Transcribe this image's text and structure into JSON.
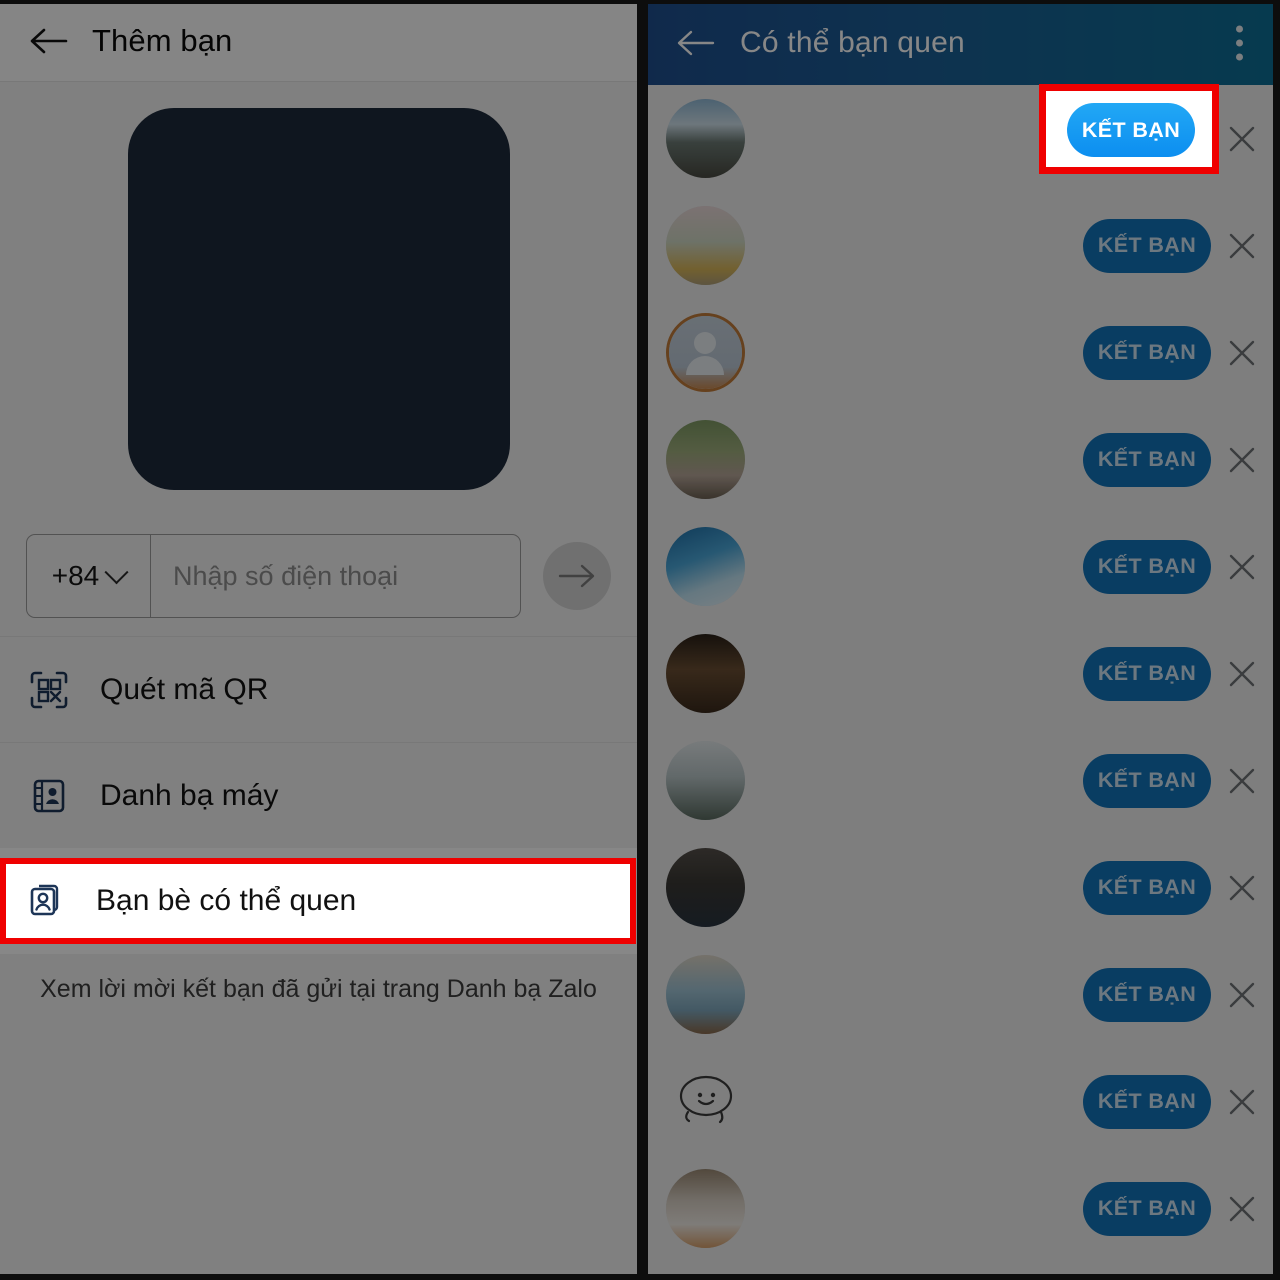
{
  "left_panel": {
    "appbar": {
      "back_icon": "arrow-left-icon",
      "title": "Thêm bạn"
    },
    "qr_placeholder": {
      "color": "#1e2b3b",
      "label": "qr-code-placeholder"
    },
    "phone": {
      "country_code": "+84",
      "dropdown_icon": "chevron-down-icon",
      "placeholder": "Nhập số điện thoại",
      "value": "",
      "submit_icon": "arrow-right-icon"
    },
    "menu": [
      {
        "icon": "qr-scan-icon",
        "label": "Quét mã QR",
        "highlighted": false
      },
      {
        "icon": "contacts-book-icon",
        "label": "Danh bạ máy",
        "highlighted": false
      },
      {
        "icon": "people-you-may-know-icon",
        "label": "Bạn bè có thể quen",
        "highlighted": true
      }
    ],
    "footer_note": "Xem lời mời kết bạn đã gửi tại trang Danh bạ Zalo"
  },
  "right_panel": {
    "appbar": {
      "back_icon": "arrow-left-icon",
      "title": "Có thể bạn quen",
      "overflow_icon": "more-vertical-icon"
    },
    "suggestion_rows": [
      {
        "avatar": "photo-beach-woman",
        "action_label": "KẾT BẠN",
        "dismiss_icon": "close-icon",
        "highlighted": true
      },
      {
        "avatar": "photo-woman-sunflowers",
        "action_label": "KẾT BẠN",
        "dismiss_icon": "close-icon",
        "highlighted": false
      },
      {
        "avatar": "photo-default-avatar-ring",
        "action_label": "KẾT BẠN",
        "dismiss_icon": "close-icon",
        "highlighted": false
      },
      {
        "avatar": "photo-couple-trees",
        "action_label": "KẾT BẠN",
        "dismiss_icon": "close-icon",
        "highlighted": false
      },
      {
        "avatar": "photo-blue-anime-art",
        "action_label": "KẾT BẠN",
        "dismiss_icon": "close-icon",
        "highlighted": false
      },
      {
        "avatar": "photo-woman-cafe-night",
        "action_label": "KẾT BẠN",
        "dismiss_icon": "close-icon",
        "highlighted": false
      },
      {
        "avatar": "photo-two-people-wedding-arch",
        "action_label": "KẾT BẠN",
        "dismiss_icon": "close-icon",
        "highlighted": false
      },
      {
        "avatar": "photo-person-hat-dark",
        "action_label": "KẾT BẠN",
        "dismiss_icon": "close-icon",
        "highlighted": false
      },
      {
        "avatar": "photo-person-blue-sofa",
        "action_label": "KẾT BẠN",
        "dismiss_icon": "close-icon",
        "highlighted": false
      },
      {
        "avatar": "doodle-smiley-sticker",
        "action_label": "KẾT BẠN",
        "dismiss_icon": "close-icon",
        "highlighted": false
      },
      {
        "avatar": "photo-tabby-cat",
        "action_label": "KẾT BẠN",
        "dismiss_icon": "close-icon",
        "highlighted": false
      }
    ]
  },
  "annotation": {
    "highlight_color": "#ef0000",
    "left_target": "Bạn bè có thể quen",
    "right_target": "KẾT BẠN"
  },
  "colors": {
    "appbar_blue_start": "#1f4f8f",
    "appbar_blue_end": "#0d6f96",
    "button_blue": "#1273b9",
    "button_blue_active": "#0c8ef0",
    "icon_blue": "#1d3557",
    "panel_bg": "#f2f2f2"
  }
}
